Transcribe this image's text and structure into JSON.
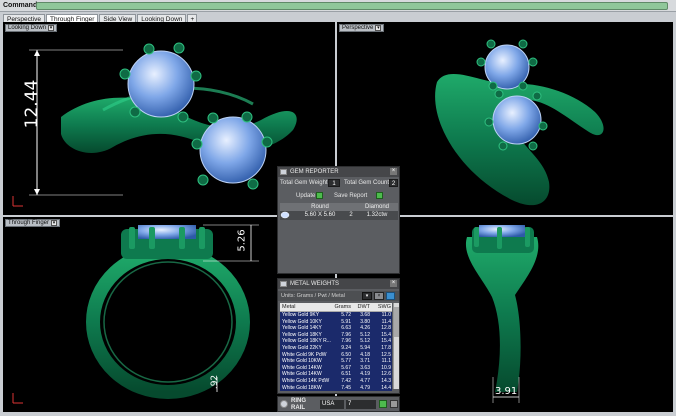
{
  "command": {
    "label": "Command:",
    "value": ""
  },
  "tabs": [
    {
      "label": "Perspective",
      "active": false
    },
    {
      "label": "Through Finger",
      "active": true
    },
    {
      "label": "Side View",
      "active": false
    },
    {
      "label": "Looking Down",
      "active": false
    },
    {
      "label": "+",
      "active": false
    }
  ],
  "viewports": {
    "top_left": {
      "label": "Looking Down",
      "dimension": "12.44"
    },
    "top_right": {
      "label": "Perspective"
    },
    "bottom_left": {
      "label": "Through Finger",
      "dimension_top": "5.26",
      "dimension_bottom": ".92"
    },
    "bottom_right": {
      "label": "",
      "dimension": "3.91"
    }
  },
  "gem_reporter": {
    "title": "GEM REPORTER",
    "total_weight_label": "Total Gem Weight",
    "total_weight_value": "1",
    "total_count_label": "Total Gem Count",
    "total_count_value": "2",
    "update_label": "Update",
    "save_label": "Save Report",
    "columns": [
      "",
      "Round",
      "",
      "Diamond"
    ],
    "rows": [
      {
        "size": "5.60 X 5.60",
        "count": "2",
        "weight": "1.32ctw"
      }
    ]
  },
  "metal_weights": {
    "title": "METAL WEIGHTS",
    "subtitle": "Units: Grams / Pwt / Metal",
    "columns": [
      "Metal",
      "Grams",
      "DWT",
      "SWG"
    ],
    "rows": [
      [
        "Yellow Gold 9KY",
        "5.72",
        "3.68",
        "11.0"
      ],
      [
        "Yellow Gold 10KY",
        "5.91",
        "3.80",
        "11.4"
      ],
      [
        "Yellow Gold 14KY",
        "6.63",
        "4.26",
        "12.8"
      ],
      [
        "Yellow Gold 18KY",
        "7.96",
        "5.12",
        "15.4"
      ],
      [
        "Yellow Gold 18KY R...",
        "7.96",
        "5.12",
        "15.4"
      ],
      [
        "Yellow Gold 22KY",
        "9.24",
        "5.94",
        "17.8"
      ],
      [
        "White Gold 9K PdW",
        "6.50",
        "4.18",
        "12.5"
      ],
      [
        "White Gold 10KW",
        "5.77",
        "3.71",
        "11.1"
      ],
      [
        "White Gold 14KW",
        "5.67",
        "3.63",
        "10.9"
      ],
      [
        "White Gold 14KW",
        "6.51",
        "4.19",
        "12.6"
      ],
      [
        "White Gold 14K PdW",
        "7.42",
        "4.77",
        "14.3"
      ],
      [
        "White Gold 18KW",
        "7.45",
        "4.79",
        "14.4"
      ]
    ]
  },
  "ring_size": {
    "line1": "RING",
    "line2": "RAIL",
    "standard": "USA",
    "size": "7"
  },
  "colors": {
    "metal": "#0e7a4e",
    "gem": "#5d8fd8",
    "prong": "#0f6b45"
  }
}
